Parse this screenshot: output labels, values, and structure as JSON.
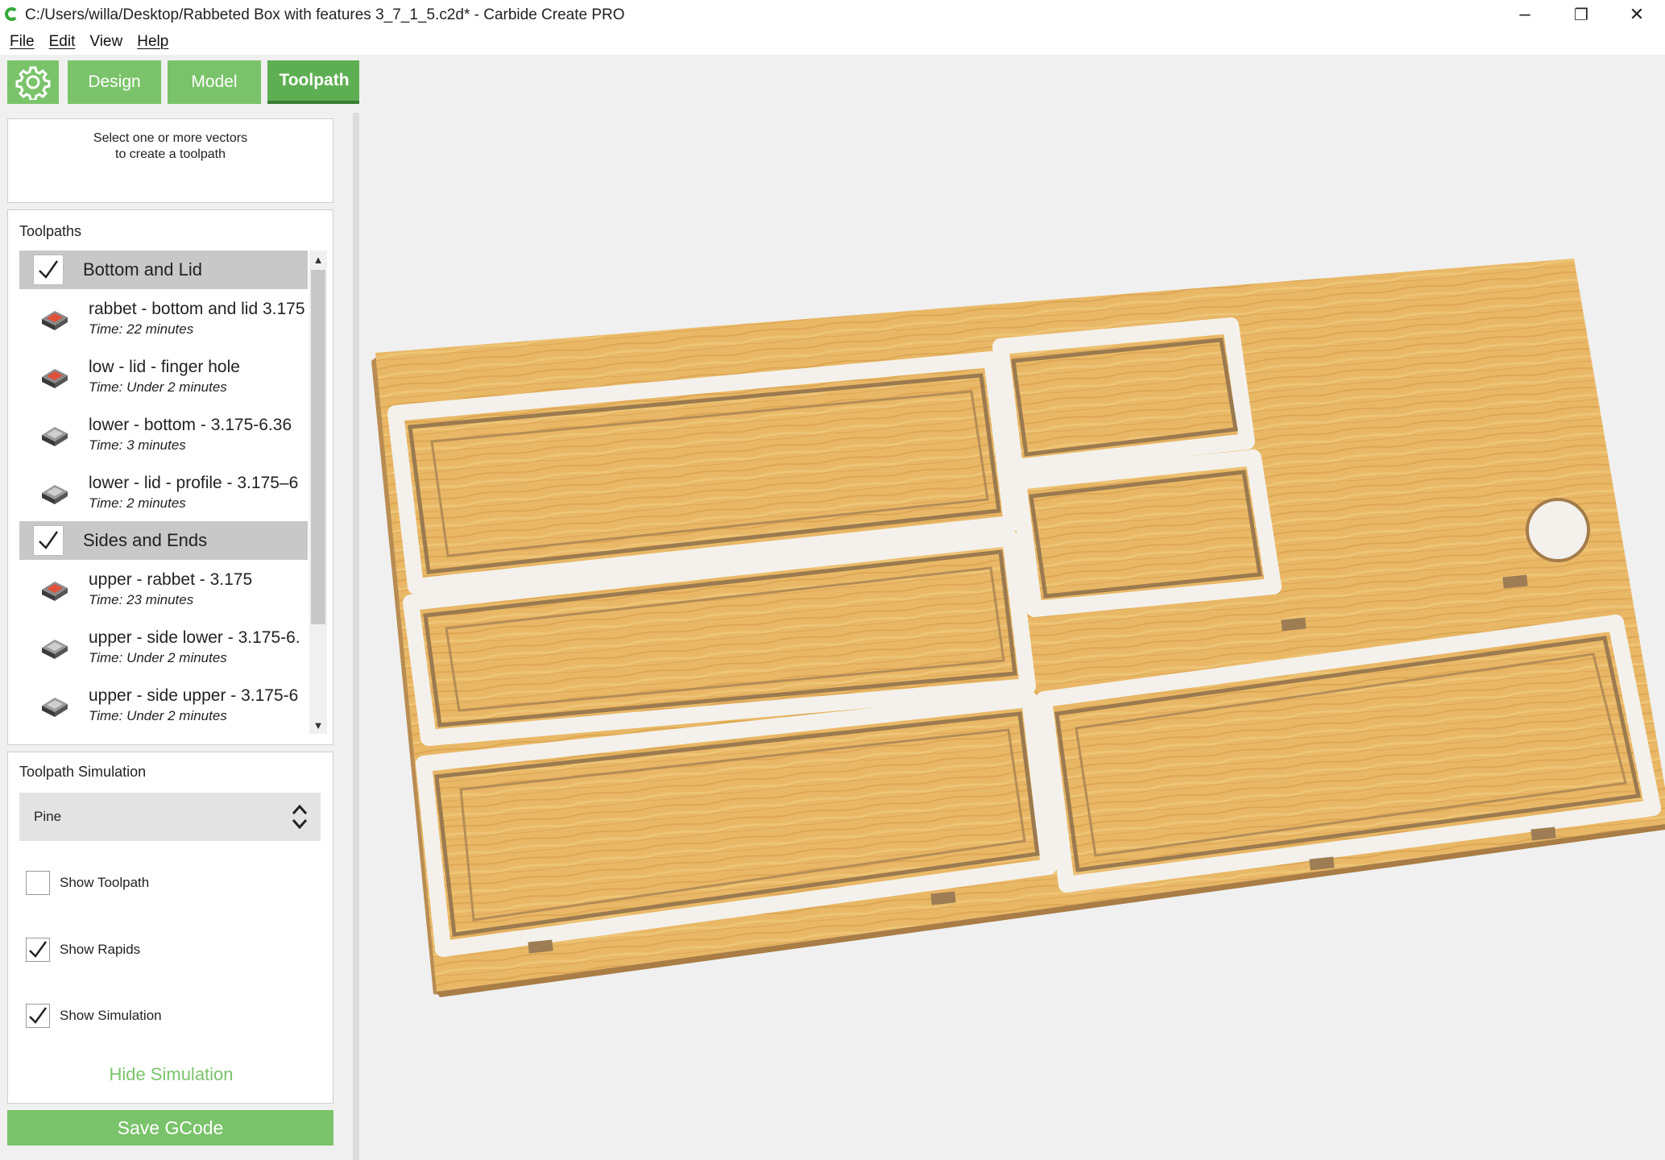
{
  "window": {
    "title": "C:/Users/willa/Desktop/Rabbeted Box with features 3_7_1_5.c2d* - Carbide Create PRO",
    "minimize_glyph": "–",
    "restore_glyph": "❐",
    "close_glyph": "✕"
  },
  "menu": [
    "File",
    "Edit",
    "View",
    "Help"
  ],
  "mode_tabs": {
    "design": "Design",
    "model": "Model",
    "toolpath": "Toolpath"
  },
  "hint": {
    "line1": "Select one or more vectors",
    "line2": "to create a toolpath"
  },
  "toolpaths": {
    "title": "Toolpaths",
    "groups": [
      {
        "label": "Bottom and Lid",
        "checked": true,
        "items": [
          {
            "name": "rabbet - bottom and lid 3.175",
            "time": "Time: 22 minutes",
            "icon": "pocket-icon"
          },
          {
            "name": "low - lid - finger hole",
            "time": "Time: Under 2 minutes",
            "icon": "pocket-icon"
          },
          {
            "name": "lower - bottom - 3.175-6.36",
            "time": "Time: 3 minutes",
            "icon": "profile-icon"
          },
          {
            "name": "lower - lid - profile - 3.175–6",
            "time": "Time: 2 minutes",
            "icon": "profile-icon"
          }
        ]
      },
      {
        "label": "Sides and Ends",
        "checked": true,
        "items": [
          {
            "name": "upper - rabbet - 3.175",
            "time": "Time: 23 minutes",
            "icon": "pocket-icon"
          },
          {
            "name": "upper - side lower - 3.175-6.",
            "time": "Time: Under 2 minutes",
            "icon": "profile-icon"
          },
          {
            "name": "upper - side upper - 3.175-6",
            "time": "Time: Under 2 minutes",
            "icon": "profile-icon"
          }
        ]
      }
    ]
  },
  "simulation": {
    "title": "Toolpath Simulation",
    "material": "Pine",
    "show_toolpath": {
      "label": "Show Toolpath",
      "checked": false
    },
    "show_rapids": {
      "label": "Show Rapids",
      "checked": true
    },
    "show_simulation": {
      "label": "Show Simulation",
      "checked": true
    },
    "hide_label": "Hide Simulation"
  },
  "save_label": "Save GCode",
  "colors": {
    "accent": "#7ac36a",
    "accent_active": "#5eaf53",
    "wood": "#e8b868",
    "wood_dark": "#a37e4c"
  }
}
